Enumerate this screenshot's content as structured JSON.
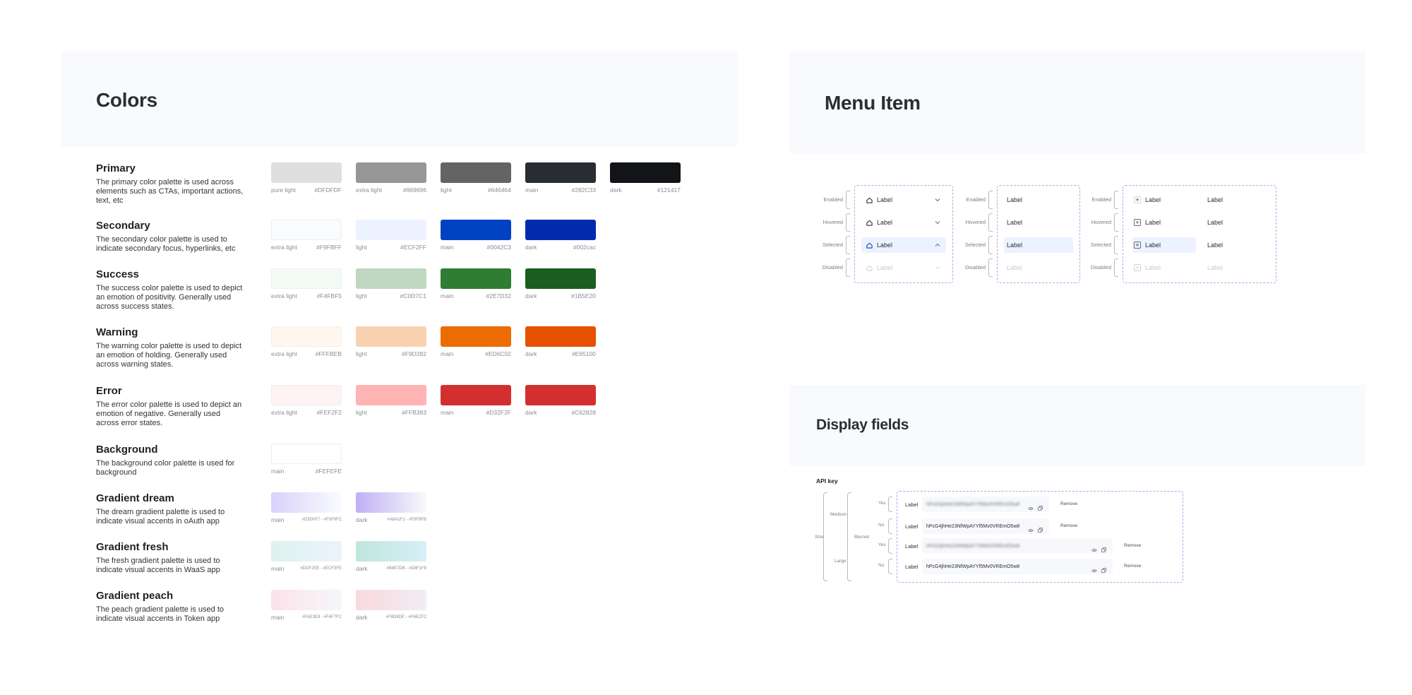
{
  "colors": {
    "title": "Colors",
    "groups": [
      {
        "name": "Primary",
        "desc": "The primary color palette is used across elements such as CTAs, important actions, text, etc",
        "swatches": [
          {
            "name": "pure light",
            "hex": "#DFDFDF",
            "color": "#DFDFDF"
          },
          {
            "name": "extra light",
            "hex": "#969696",
            "color": "#969696"
          },
          {
            "name": "light",
            "hex": "#646464",
            "color": "#646464"
          },
          {
            "name": "main",
            "hex": "#282C33",
            "color": "#282C33"
          },
          {
            "name": "dark",
            "hex": "#121417",
            "color": "#121417"
          }
        ]
      },
      {
        "name": "Secondary",
        "desc": "The secondary color palette is used to indicate secondary focus, hyperlinks, etc",
        "swatches": [
          {
            "name": "extra light",
            "hex": "#F9FBFF",
            "color": "#F9FBFF"
          },
          {
            "name": "light",
            "hex": "#ECF2FF",
            "color": "#ECF2FF"
          },
          {
            "name": "main",
            "hex": "#0042C3",
            "color": "#0042C3"
          },
          {
            "name": "dark",
            "hex": "#002cac",
            "color": "#002CAC"
          }
        ]
      },
      {
        "name": "Success",
        "desc": "The success color palette is used to depict an emotion of positivity. Generally used across success states.",
        "swatches": [
          {
            "name": "extra light",
            "hex": "#F4FBF5",
            "color": "#F4FBF5"
          },
          {
            "name": "light",
            "hex": "#C0D7C1",
            "color": "#C0D7C1"
          },
          {
            "name": "main",
            "hex": "#2E7D32",
            "color": "#2E7D32"
          },
          {
            "name": "dark",
            "hex": "#1B5E20",
            "color": "#1B5E20"
          }
        ]
      },
      {
        "name": "Warning",
        "desc": "The warning color palette is used to depict an emotion of holding. Generally used across warning states.",
        "swatches": [
          {
            "name": "extra light",
            "hex": "#FFFBEB",
            "color": "#FFF6EE"
          },
          {
            "name": "light",
            "hex": "#F9D282",
            "color": "#F9D2B2"
          },
          {
            "name": "main",
            "hex": "#ED6C02",
            "color": "#ED6C02"
          },
          {
            "name": "dark",
            "hex": "#E65100",
            "color": "#E65100"
          }
        ]
      },
      {
        "name": "Error",
        "desc": "The error color palette is used to depict an emotion of negative. Generally used across error states.",
        "swatches": [
          {
            "name": "extra light",
            "hex": "#FEF2F2",
            "color": "#FEF2F2"
          },
          {
            "name": "light",
            "hex": "#FFB383",
            "color": "#FFB3B3"
          },
          {
            "name": "main",
            "hex": "#D32F2F",
            "color": "#D32F2F"
          },
          {
            "name": "dark",
            "hex": "#C62828",
            "color": "#D32F2F"
          }
        ]
      },
      {
        "name": "Background",
        "desc": "The background color palette is used for background",
        "swatches": [
          {
            "name": "main",
            "hex": "#FEFEFE",
            "color": "#FEFEFE"
          }
        ]
      },
      {
        "name": "Gradient dream",
        "desc": "The dream gradient palette is used to indicate visual accents in oAuth app",
        "swatches": [
          {
            "name": "main",
            "hex": "#D3D0F7 - #F0F6FC",
            "color": "linear-gradient(90deg,#D8D2FA,#FAFBFE)"
          },
          {
            "name": "dark",
            "hex": "#A8A1F1 - #F8F9FB",
            "color": "linear-gradient(90deg,#BFB0F4,#F8F9FB)"
          }
        ]
      },
      {
        "name": "Gradient fresh",
        "desc": "The fresh gradient palette is used to indicate visual accents in WaaS app",
        "swatches": [
          {
            "name": "main",
            "hex": "#DDF2EE - #ECF3FE",
            "color": "linear-gradient(90deg,#DDF2EE,#ECF3FE)"
          },
          {
            "name": "dark",
            "hex": "#B8E7DB - #D8F1F8",
            "color": "linear-gradient(90deg,#BFE7DE,#D8EEF6)"
          }
        ]
      },
      {
        "name": "Gradient peach",
        "desc": "The peach gradient palette is used to indicate visual accents in Token app",
        "swatches": [
          {
            "name": "main",
            "hex": "#FAE3E9 - #F4F7FC",
            "color": "linear-gradient(90deg,#FBE3E9,#F6F7FB)"
          },
          {
            "name": "dark",
            "hex": "#F8D8DE - #F6ECF2",
            "color": "linear-gradient(90deg,#F9D9DF,#F2ECF4)"
          }
        ]
      }
    ]
  },
  "menu_item": {
    "title": "Menu Item",
    "states": [
      "Enabled",
      "Hovered",
      "Selected",
      "Disabled"
    ],
    "label": "Label"
  },
  "display_fields": {
    "title": "Display fields",
    "section": "API key",
    "size_lbl": "Size",
    "medium_lbl": "Medium",
    "large_lbl": "Large",
    "bluured_lbl": "Blurred",
    "yes_lbl": "Yes",
    "no_lbl": "No",
    "field_label": "Label",
    "key_value": "hPcG4jhHe23NfWpAYYf5Mv0VREmO5w8",
    "remove_label": "Remove"
  },
  "accent_colors": {
    "dashed_border": "#B4A6E6",
    "selected_bg": "#ECF2FF",
    "panel_bg": "#F9FAFD"
  }
}
